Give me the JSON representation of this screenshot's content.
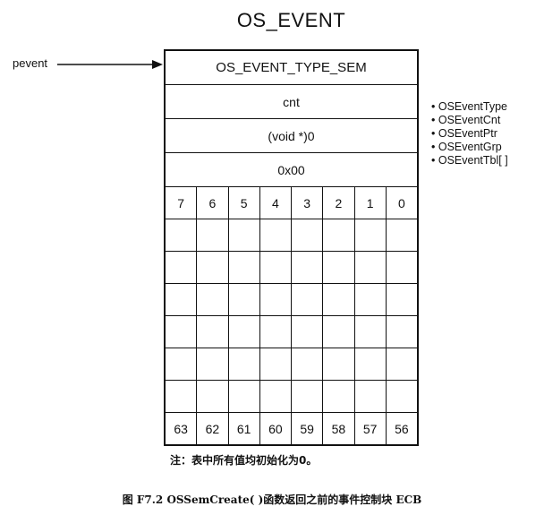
{
  "title": "OS_EVENT",
  "pointer_label": "pevent",
  "fields": [
    "OS_EVENT_TYPE_SEM",
    "cnt",
    "(void *)0",
    "0x00"
  ],
  "bit_header": [
    "7",
    "6",
    "5",
    "4",
    "3",
    "2",
    "1",
    "0"
  ],
  "bit_footer": [
    "63",
    "62",
    "61",
    "60",
    "59",
    "58",
    "57",
    "56"
  ],
  "legend": [
    "OSEventType",
    "OSEventCnt",
    "OSEventPtr",
    "OSEventGrp",
    "OSEventTbl[ ]"
  ],
  "note": "注：表中所有值均初始化为0。",
  "caption": "图 F7.2   OSSemCreate( )函数返回之前的事件控制块 ECB"
}
